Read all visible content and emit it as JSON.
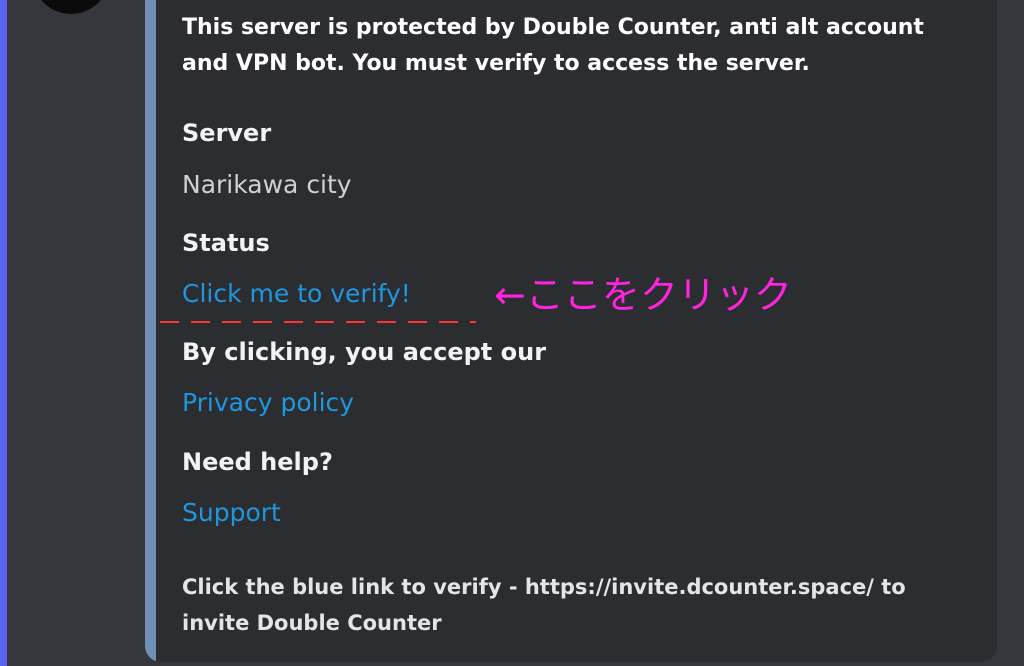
{
  "embed": {
    "description": "This server is protected by Double Counter, anti alt account and VPN bot. You must verify to access the server.",
    "fields": [
      {
        "name": "Server",
        "value": "Narikawa city",
        "is_link": false
      },
      {
        "name": "Status",
        "value": "Click me to verify!",
        "is_link": true
      },
      {
        "name": "By clicking, you accept our",
        "value": "Privacy policy",
        "is_link": true
      },
      {
        "name": "Need help?",
        "value": "Support",
        "is_link": true
      }
    ],
    "footer": "Click the blue link to verify - https://invite.dcounter.space/ to invite Double Counter"
  },
  "annotation": {
    "text": "←ここをクリック",
    "color": "#ff23de"
  },
  "colors": {
    "background": "#36373d",
    "embed_background": "#2b2d31",
    "embed_accent": "#6f8fb7",
    "link": "#1f97df",
    "left_bar": "#5865f2",
    "underline_annotation": "#ff3333"
  }
}
